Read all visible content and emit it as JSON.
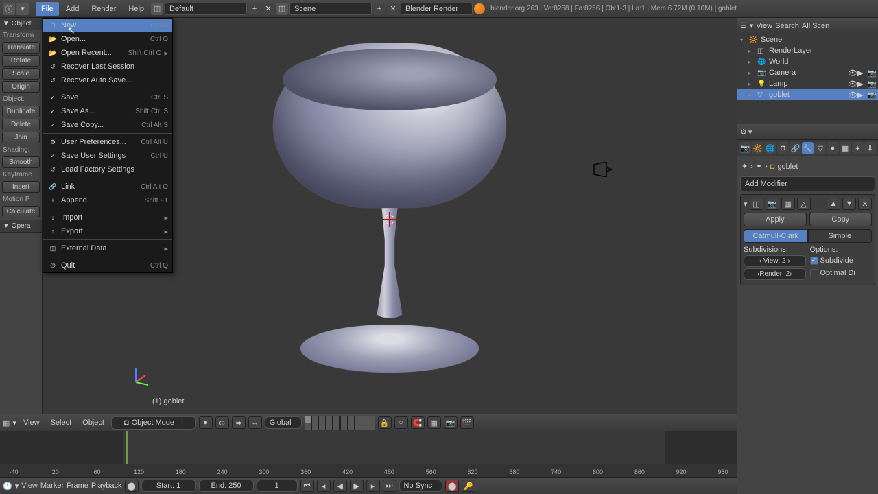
{
  "top_menu": {
    "items": [
      "File",
      "Add",
      "Render",
      "Help"
    ],
    "layout": "Default",
    "scene": "Scene",
    "renderer": "Blender Render",
    "info": "blender.org 263 | Ve:8258 | Fa:8256 | Ob:1-3 | La:1 | Mem:6.72M (0.10M) | goblet"
  },
  "file_menu": [
    {
      "label": "New",
      "shortcut": "Ctrl N",
      "highlighted": true,
      "icon": "□"
    },
    {
      "label": "Open...",
      "shortcut": "Ctrl O",
      "icon": "📂"
    },
    {
      "label": "Open Recent...",
      "shortcut": "Shift Ctrl O",
      "submenu": true,
      "icon": "📂"
    },
    {
      "label": "Recover Last Session",
      "icon": "↺"
    },
    {
      "label": "Recover Auto Save...",
      "icon": "↺"
    },
    {
      "sep": true
    },
    {
      "label": "Save",
      "shortcut": "Ctrl S",
      "icon": "✓"
    },
    {
      "label": "Save As...",
      "shortcut": "Shift Ctrl S",
      "icon": "✓"
    },
    {
      "label": "Save Copy...",
      "shortcut": "Ctrl Alt S",
      "icon": "✓"
    },
    {
      "sep": true
    },
    {
      "label": "User Preferences...",
      "shortcut": "Ctrl Alt U",
      "icon": "⚙"
    },
    {
      "label": "Save User Settings",
      "shortcut": "Ctrl U",
      "icon": "✓"
    },
    {
      "label": "Load Factory Settings",
      "icon": "↺"
    },
    {
      "sep": true
    },
    {
      "label": "Link",
      "shortcut": "Ctrl Alt O",
      "icon": "🔗"
    },
    {
      "label": "Append",
      "shortcut": "Shift F1",
      "icon": "+"
    },
    {
      "sep": true
    },
    {
      "label": "Import",
      "submenu": true,
      "icon": "↓"
    },
    {
      "label": "Export",
      "submenu": true,
      "icon": "↑"
    },
    {
      "sep": true
    },
    {
      "label": "External Data",
      "submenu": true,
      "icon": "◫"
    },
    {
      "sep": true
    },
    {
      "label": "Quit",
      "shortcut": "Ctrl Q",
      "icon": "⏻"
    }
  ],
  "tool_shelf": {
    "header": "▼ Object",
    "groups": [
      {
        "label": "Transform",
        "buttons": [
          "Translate",
          "Rotate",
          "Scale"
        ]
      },
      {
        "label": "",
        "buttons": [
          "Origin"
        ]
      },
      {
        "label": "Object:",
        "buttons": [
          "Duplicate",
          "Delete",
          "Join"
        ]
      },
      {
        "label": "Shading:",
        "buttons": [
          "Smooth"
        ]
      },
      {
        "label": "Keyframe",
        "buttons": [
          "Insert"
        ]
      },
      {
        "label": "Motion P",
        "buttons": [
          "Calculate"
        ]
      }
    ],
    "footer": "▼ Opera"
  },
  "viewport": {
    "object_label": "(1) goblet"
  },
  "view3d_header": {
    "menus": [
      "View",
      "Select",
      "Object"
    ],
    "mode": "Object Mode",
    "orientation": "Global"
  },
  "timeline": {
    "ticks": [
      -40,
      20,
      60,
      120,
      180,
      240,
      300,
      360,
      420,
      480,
      560,
      620,
      680,
      740,
      800,
      860,
      920,
      980
    ],
    "tick_labels": [
      "-40",
      "20",
      "60",
      "120",
      "180",
      "240",
      "300",
      "360",
      "420",
      "480",
      "560",
      "620",
      "680",
      "740",
      "800",
      "860",
      "920",
      "980"
    ]
  },
  "playback": {
    "menus": [
      "View",
      "Marker",
      "Frame",
      "Playback"
    ],
    "start": "Start: 1",
    "end": "End: 250",
    "current": "1",
    "sync": "No Sync"
  },
  "outliner": {
    "header_menus": [
      "View",
      "Search"
    ],
    "filter": "All Scen",
    "tree": [
      {
        "label": "Scene",
        "icon": "🔆",
        "indent": 0,
        "expanded": true
      },
      {
        "label": "RenderLayer",
        "icon": "◫",
        "indent": 1
      },
      {
        "label": "World",
        "icon": "🌐",
        "indent": 1
      },
      {
        "label": "Camera",
        "icon": "📷",
        "indent": 1,
        "ctrls": true
      },
      {
        "label": "Lamp",
        "icon": "💡",
        "indent": 1,
        "ctrls": true
      },
      {
        "label": "goblet",
        "icon": "▽",
        "indent": 1,
        "selected": true,
        "ctrls": true
      }
    ]
  },
  "properties": {
    "breadcrumb": [
      "✦",
      "✦",
      "goblet"
    ],
    "add_modifier": "Add Modifier",
    "modifier": {
      "apply": "Apply",
      "copy": "Copy",
      "type_tabs": [
        "Catmull-Clark",
        "Simple"
      ],
      "subdivisions_label": "Subdivisions:",
      "view": "‹ View: 2 ›",
      "render": "‹Render: 2›",
      "options_label": "Options:",
      "subdivide": "Subdivide",
      "optimal": "Optimal Di"
    }
  }
}
